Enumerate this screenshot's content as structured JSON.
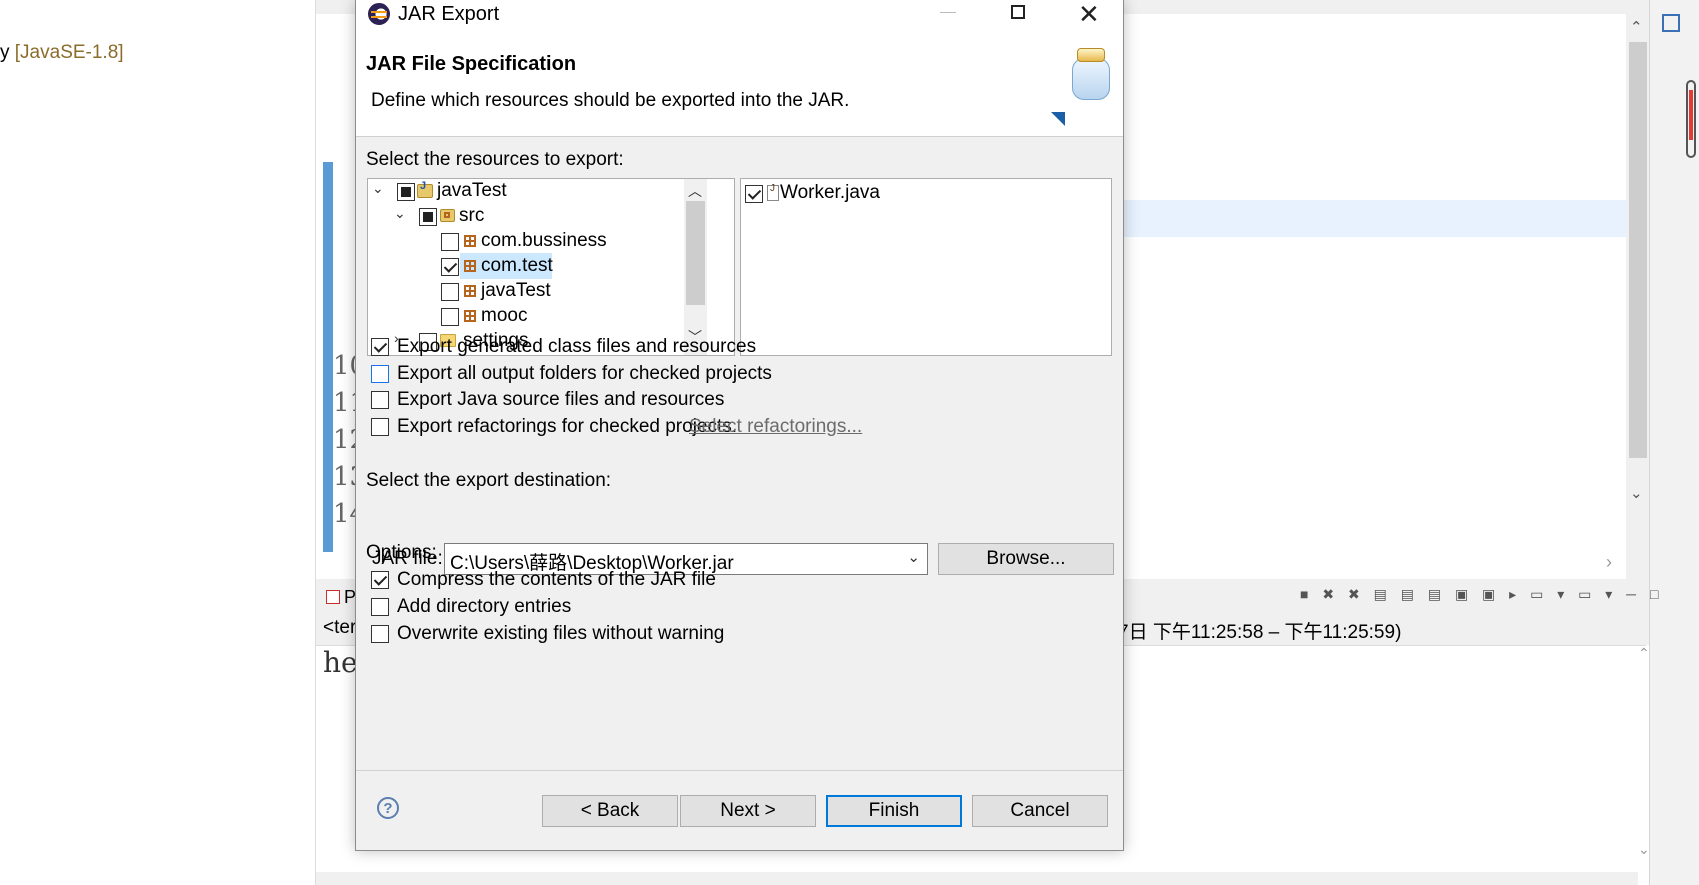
{
  "background": {
    "left_tree_prefix": "y",
    "left_tree_jre": "[JavaSE-1.8]",
    "line_numbers": [
      "10",
      "11",
      "12",
      "13",
      "14"
    ],
    "console_tab_label": "P",
    "console_desc_start": "<ter",
    "console_desc_time": "7日 下午11:25:58 – 下午11:25:59)",
    "console_output": "he"
  },
  "dialog": {
    "title": "JAR Export",
    "header_title": "JAR File Specification",
    "header_desc": "Define which resources should be exported into the JAR.",
    "resources_label": "Select the resources to export:",
    "tree": [
      {
        "label": "javaTest",
        "state": "partial",
        "icon": "java-project-icon",
        "expanded": true
      },
      {
        "label": "src",
        "state": "partial",
        "icon": "source-folder-icon",
        "expanded": true
      },
      {
        "label": "com.bussiness",
        "state": "unchecked",
        "icon": "package-icon"
      },
      {
        "label": "com.test",
        "state": "checked",
        "icon": "package-icon",
        "selected": true
      },
      {
        "label": "javaTest",
        "state": "unchecked",
        "icon": "package-icon"
      },
      {
        "label": "mooc",
        "state": "unchecked",
        "icon": "package-icon"
      },
      {
        "label": "settings",
        "state": "unchecked",
        "icon": "folder-icon",
        "expanded": false
      }
    ],
    "files": [
      {
        "label": "Worker.java",
        "state": "checked",
        "icon": "java-file-icon"
      }
    ],
    "export_options": [
      {
        "label": "Export generated class files and resources",
        "checked": true
      },
      {
        "label": "Export all output folders for checked projects",
        "checked": false
      },
      {
        "label": "Export Java source files and resources",
        "checked": false
      },
      {
        "label": "Export refactorings for checked projects.",
        "checked": false
      }
    ],
    "select_refactorings_link": "Select refactorings...",
    "destination_label": "Select the export destination:",
    "jar_file_label": "JAR file:",
    "jar_file_value": "C:\\Users\\薛路\\Desktop\\Worker.jar",
    "browse_button": "Browse...",
    "options_label": "Options:",
    "options": [
      {
        "label": "Compress the contents of the JAR file",
        "checked": true
      },
      {
        "label": "Add directory entries",
        "checked": false
      },
      {
        "label": "Overwrite existing files without warning",
        "checked": false
      }
    ],
    "buttons": {
      "back": "< Back",
      "next": "Next >",
      "finish": "Finish",
      "cancel": "Cancel"
    },
    "help_icon_glyph": "?"
  }
}
